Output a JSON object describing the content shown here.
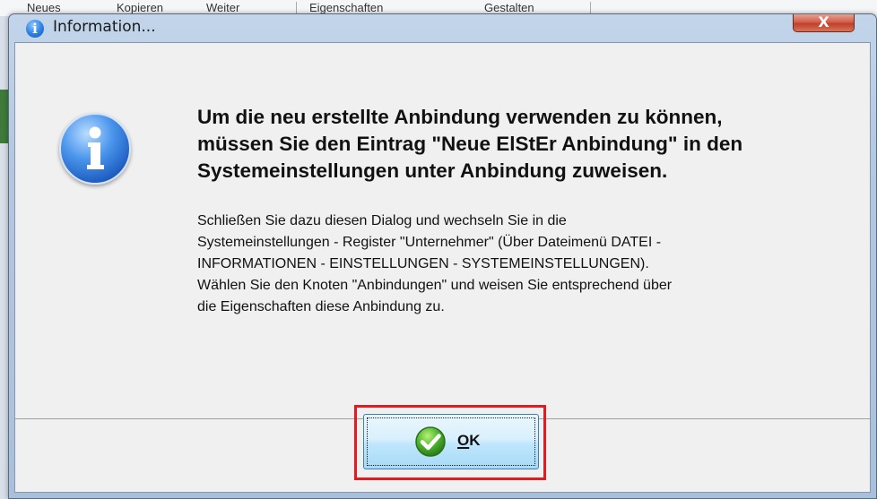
{
  "background_app": {
    "menu_items": [
      "Neues",
      "Kopieren",
      "Weiter",
      "Eigenschaften",
      "Gestalten"
    ]
  },
  "dialog": {
    "title": "Information...",
    "close_glyph": "X",
    "icon": "information-icon",
    "headline_lines": [
      "Um die neu erstellte Anbindung verwenden zu können,",
      "müssen Sie den Eintrag \"Neue ElStEr Anbindung\" in den",
      "Systemeinstellungen unter Anbindung zuweisen."
    ],
    "body_lines": [
      "Schließen Sie dazu diesen Dialog und wechseln Sie in die",
      "Systemeinstellungen - Register \"Unternehmer\" (Über Dateimenü DATEI -",
      "INFORMATIONEN - EINSTELLUNGEN - SYSTEMEINSTELLUNGEN).",
      "Wählen Sie den Knoten \"Anbindungen\" und weisen Sie entsprechend über",
      "die Eigenschaften diese Anbindung zu."
    ],
    "ok_button": {
      "label_mnemonic": "O",
      "label_rest": "K",
      "icon": "green-check-icon"
    }
  },
  "colors": {
    "highlight_border": "#e21b23",
    "title_bar": "#b3c8e1",
    "client_bg": "#f0f0f0",
    "close_button": "#c0402a"
  }
}
